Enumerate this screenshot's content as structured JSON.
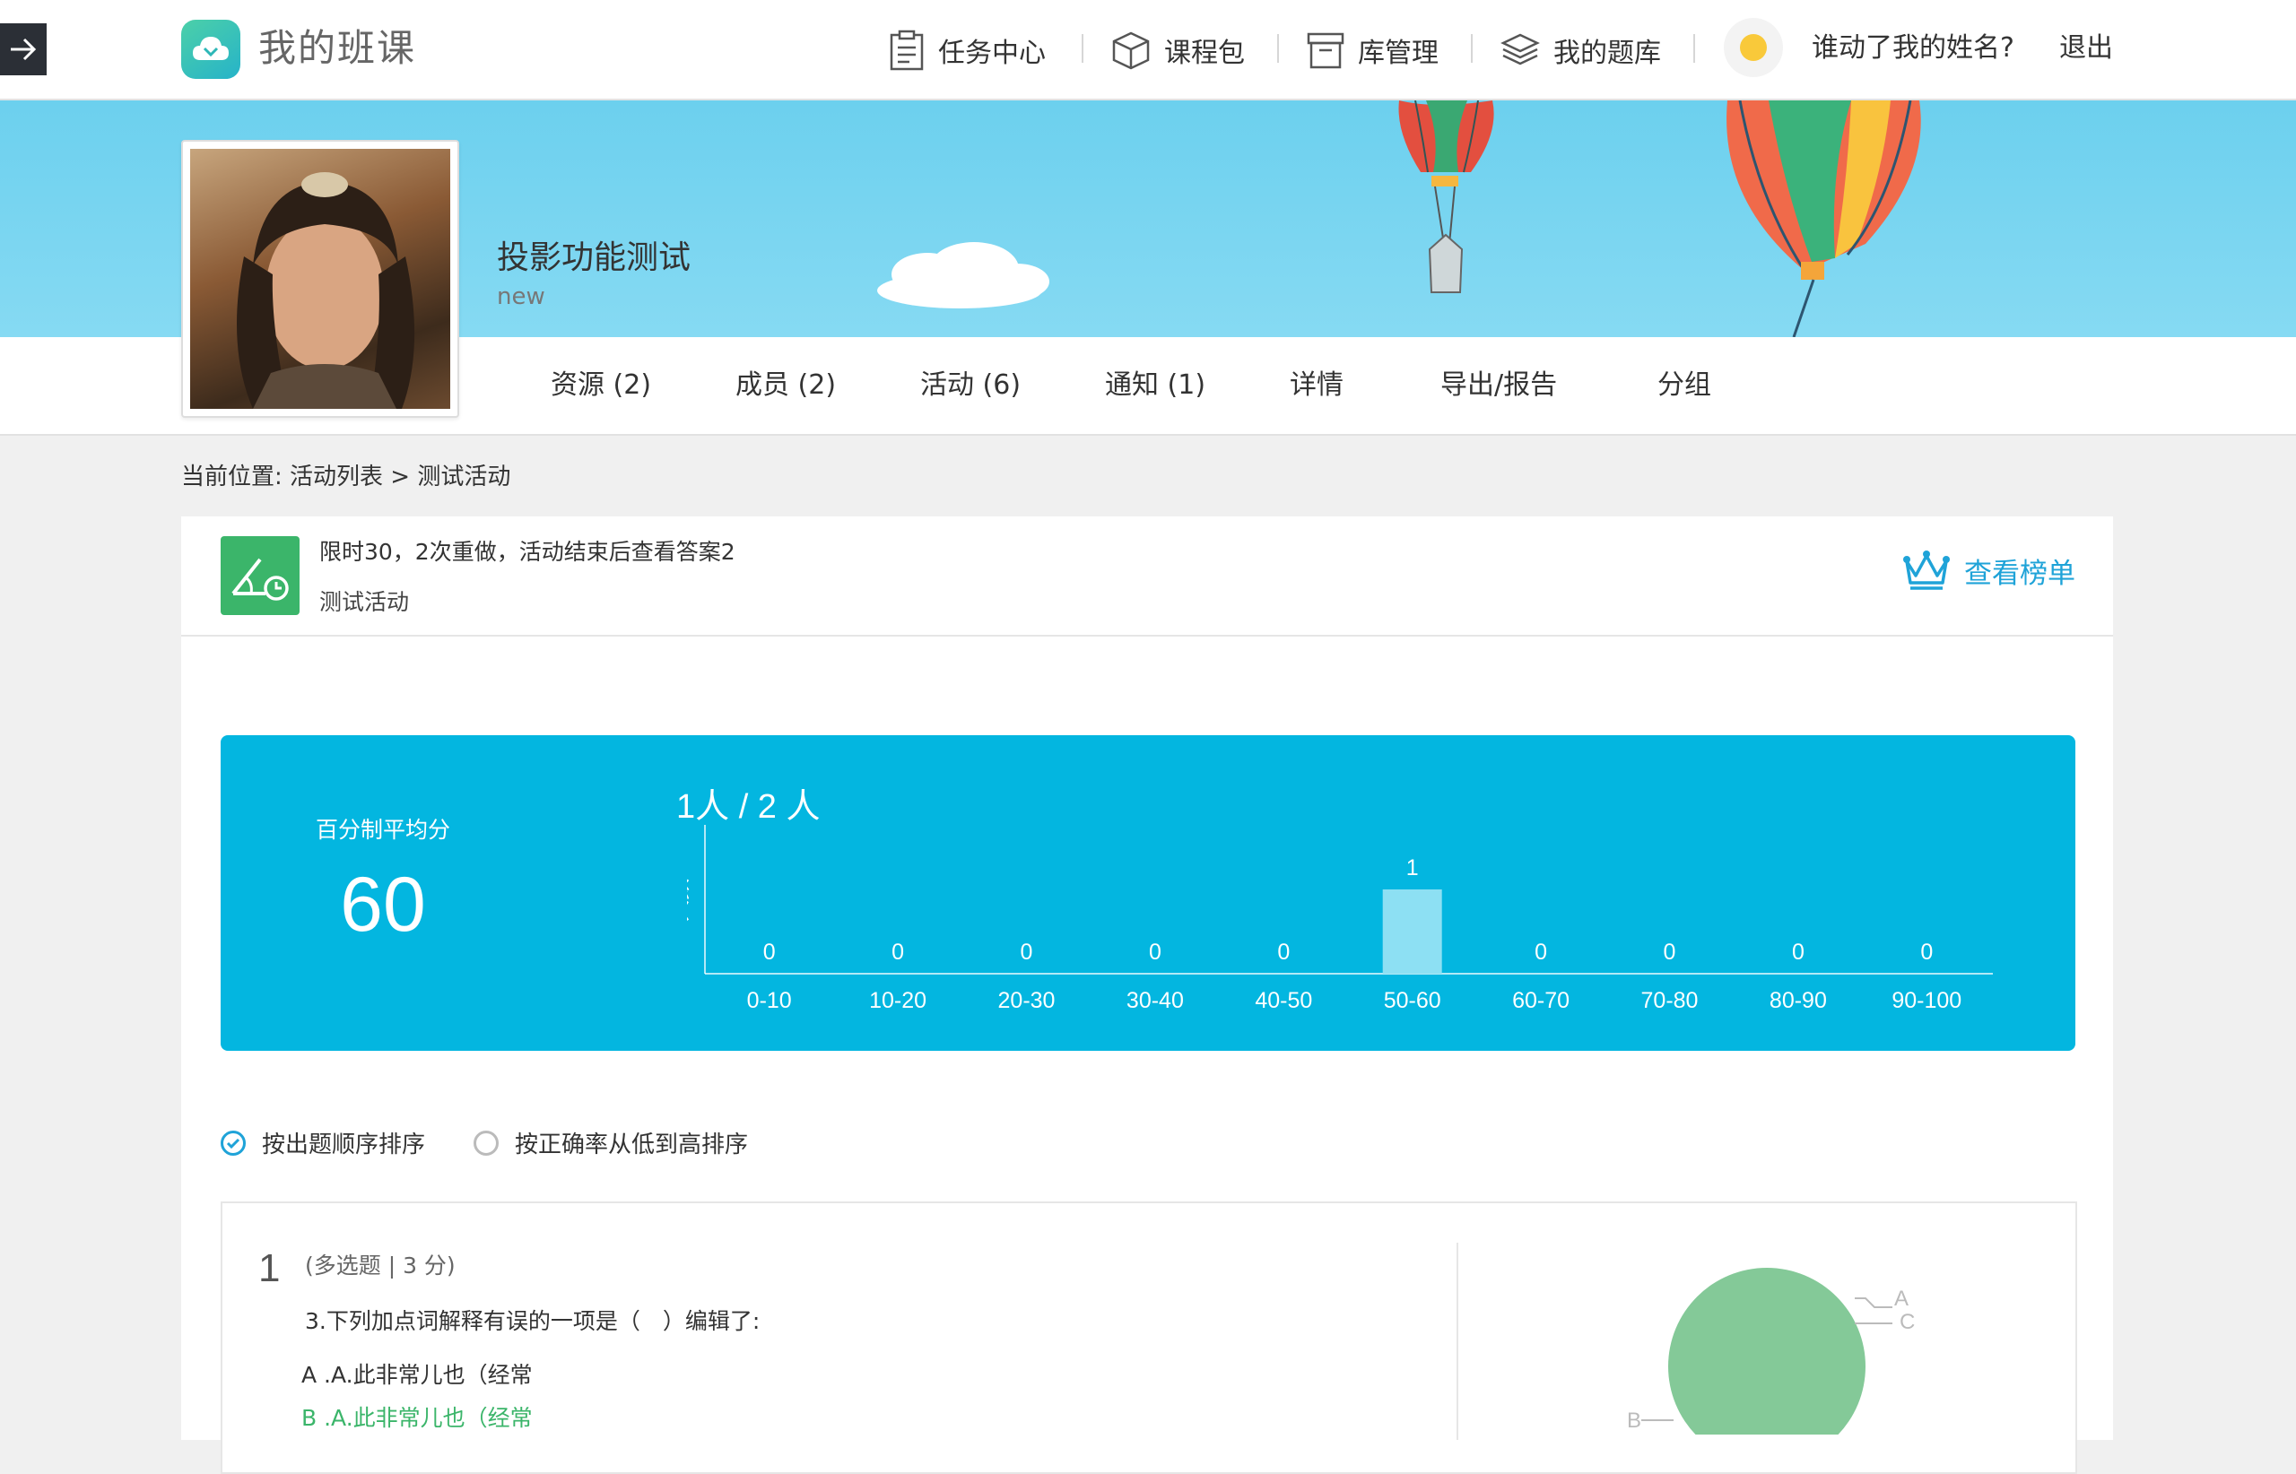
{
  "header": {
    "app_title": "我的班课",
    "nav": [
      {
        "label": "任务中心",
        "icon": "task-center-icon"
      },
      {
        "label": "课程包",
        "icon": "course-package-icon"
      },
      {
        "label": "库管理",
        "icon": "library-icon"
      },
      {
        "label": "我的题库",
        "icon": "question-bank-icon"
      }
    ],
    "user_name": "谁动了我的姓名?",
    "logout": "退出"
  },
  "class": {
    "name": "投影功能测试",
    "subtitle": "new"
  },
  "tabs": [
    {
      "label": "资源 (2)"
    },
    {
      "label": "成员 (2)"
    },
    {
      "label": "活动 (6)"
    },
    {
      "label": "通知 (1)"
    },
    {
      "label": "详情"
    },
    {
      "label": "导出/报告"
    },
    {
      "label": "分组"
    }
  ],
  "breadcrumb": "当前位置: 活动列表 > 测试活动",
  "activity": {
    "description": "限时30，2次重做，活动结束后查看答案2",
    "name": "测试活动",
    "leaderboard": "查看榜单"
  },
  "stats": {
    "avg_label": "百分制平均分",
    "avg_value": "60",
    "count_label": "1人 / 2 人"
  },
  "chart_data": {
    "type": "bar",
    "categories": [
      "0-10",
      "10-20",
      "20-30",
      "30-40",
      "40-50",
      "50-60",
      "60-70",
      "70-80",
      "80-90",
      "90-100"
    ],
    "values": [
      0,
      0,
      0,
      0,
      0,
      1,
      0,
      0,
      0,
      0
    ],
    "ylabel": "人数",
    "ylim": [
      0,
      1
    ]
  },
  "sort": {
    "by_order": "按出题顺序排序",
    "by_accuracy": "按正确率从低到高排序"
  },
  "question": {
    "number": "1",
    "meta": "(多选题 | 3 分)",
    "text": "3.下列加点词解释有误的一项是（　）编辑了:",
    "options": [
      {
        "text": "A .A.此非常儿也（经常"
      },
      {
        "text": "B .A.此非常儿也（经常"
      }
    ],
    "pie_labels": [
      "A",
      "C",
      "B"
    ]
  },
  "colors": {
    "accent": "#1fa3d8",
    "stats_bg": "#03b6e0",
    "bar_fill": "#8de0f3",
    "correct": "#3bb56a",
    "pie": "#84c998"
  }
}
